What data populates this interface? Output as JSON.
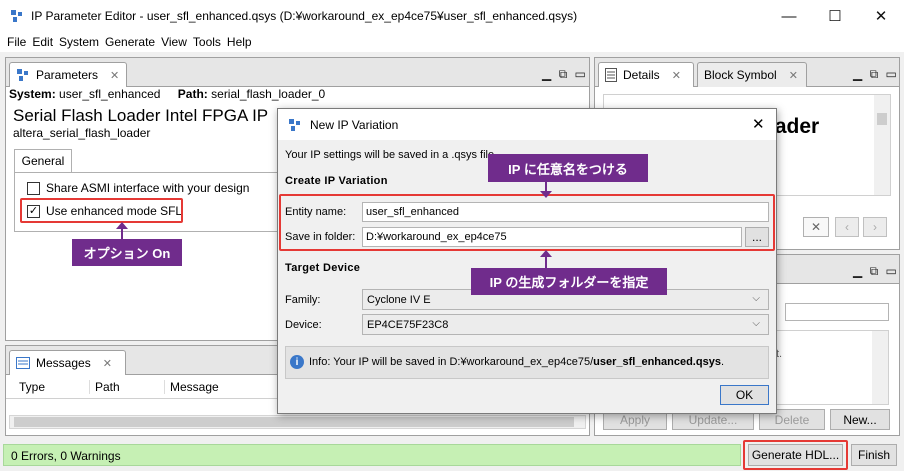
{
  "window": {
    "title": "IP Parameter Editor - user_sfl_enhanced.qsys (D:¥workaround_ex_ep4ce75¥user_sfl_enhanced.qsys)",
    "minimize": "—",
    "maximize": "☐",
    "close": "✕"
  },
  "menu": [
    "File",
    "Edit",
    "System",
    "Generate",
    "View",
    "Tools",
    "Help"
  ],
  "params_panel": {
    "tab_label": "Parameters",
    "system_label": "System:",
    "system_value": "user_sfl_enhanced",
    "path_label": "Path:",
    "path_value": "serial_flash_loader_0",
    "heading": "Serial Flash Loader Intel FPGA IP",
    "subheading": "altera_serial_flash_loader",
    "inner_tab": "General",
    "option1_label": "Share ASMI interface with your design",
    "option1_checked": false,
    "option2_label": "Use enhanced mode SFL",
    "option2_checked": true
  },
  "messages_panel": {
    "tab_label": "Messages",
    "columns": [
      "Type",
      "Path",
      "Message"
    ]
  },
  "details_panel": {
    "tab1": "Details",
    "tab2": "Block Symbol",
    "partial_text": "oader",
    "partial_small": "t.",
    "buttons": [
      "Apply",
      "Update...",
      "Delete",
      "New..."
    ]
  },
  "dialog": {
    "title": "New IP Variation",
    "close": "✕",
    "intro": "Your IP settings will be saved in a .qsys file.",
    "section1": "Create IP Variation",
    "entity_label": "Entity name:",
    "entity_value": "user_sfl_enhanced",
    "folder_label": "Save in folder:",
    "folder_value": "D:¥workaround_ex_ep4ce75",
    "browse": "...",
    "section2": "Target Device",
    "family_label": "Family:",
    "family_value": "Cyclone IV E",
    "device_label": "Device:",
    "device_value": "EP4CE75F23C8",
    "info_prefix": "Info: Your IP will be saved in D:¥workaround_ex_ep4ce75/",
    "info_file": "user_sfl_enhanced.qsys",
    "info_suffix": ".",
    "ok": "OK"
  },
  "callouts": {
    "entity": "IP に任意名をつける",
    "folder": "IP の生成フォルダーを指定",
    "option": "オプション On"
  },
  "status": {
    "text": "0 Errors, 0 Warnings",
    "generate": "Generate HDL...",
    "finish": "Finish"
  },
  "colors": {
    "accent_purple": "#702c8c",
    "highlight_red": "#e53935",
    "status_green": "#c6f0b4"
  }
}
